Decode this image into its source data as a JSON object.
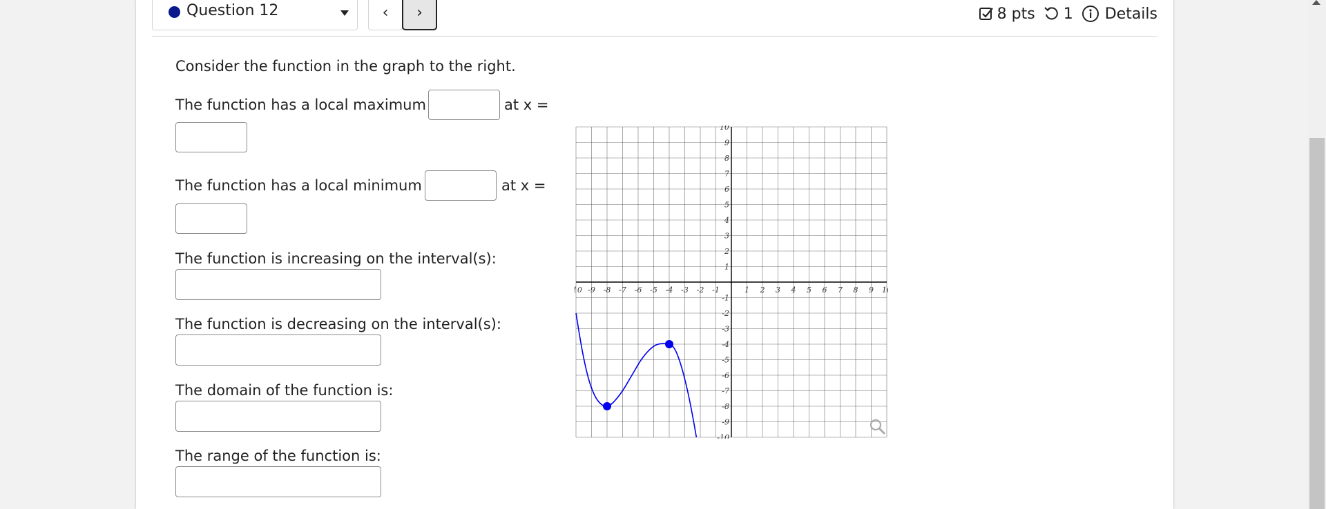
{
  "header": {
    "question_label": "Question 12",
    "points": "8 pts",
    "attempts": "1",
    "details_label": "Details",
    "prev_label": "‹",
    "next_label": "›",
    "colors": {
      "question_dot": "#0a1a8c",
      "next_border": "#222222"
    }
  },
  "prompt": {
    "intro": "Consider the function in the graph to the right.",
    "local_max_prefix": "The function has a local maximum of",
    "local_min_prefix": "The function has a local minimum of",
    "at_x": "at x =",
    "increasing": "The function is increasing on the interval(s):",
    "decreasing": "The function is decreasing on the interval(s):",
    "domain": "The domain of the function is:",
    "range": "The range of the function is:"
  },
  "inputs": {
    "local_max_value": "",
    "local_max_x": "",
    "local_min_value": "",
    "local_min_x": "",
    "increasing": "",
    "decreasing": "",
    "domain": "",
    "range": ""
  },
  "chart_data": {
    "type": "line",
    "xlim": [
      -10,
      10
    ],
    "ylim": [
      -10,
      10
    ],
    "grid": true,
    "x_ticks": [
      -10,
      -9,
      -8,
      -7,
      -6,
      -5,
      -4,
      -3,
      -2,
      -1,
      1,
      2,
      3,
      4,
      5,
      6,
      7,
      8,
      9,
      10
    ],
    "y_ticks": [
      10,
      9,
      8,
      7,
      6,
      5,
      4,
      3,
      2,
      1,
      -1,
      -2,
      -3,
      -4,
      -5,
      -6,
      -7,
      -8,
      -9,
      -10
    ],
    "series": [
      {
        "color": "#0000ee",
        "points": [
          [
            -10,
            -2
          ],
          [
            -9.6,
            -4.4
          ],
          [
            -9.2,
            -6.2
          ],
          [
            -8.8,
            -7.3
          ],
          [
            -8.4,
            -7.85
          ],
          [
            -8,
            -8
          ],
          [
            -7.6,
            -7.75
          ],
          [
            -7,
            -7
          ],
          [
            -6.4,
            -6
          ],
          [
            -5.8,
            -5
          ],
          [
            -5.2,
            -4.3
          ],
          [
            -4.7,
            -4.0
          ],
          [
            -4,
            -4
          ],
          [
            -3.6,
            -4.4
          ],
          [
            -3.2,
            -5.5
          ],
          [
            -2.8,
            -7.1
          ],
          [
            -2.5,
            -8.6
          ],
          [
            -2.25,
            -10
          ]
        ]
      }
    ],
    "marked_points": [
      [
        -8,
        -8
      ],
      [
        -4,
        -4
      ]
    ]
  }
}
